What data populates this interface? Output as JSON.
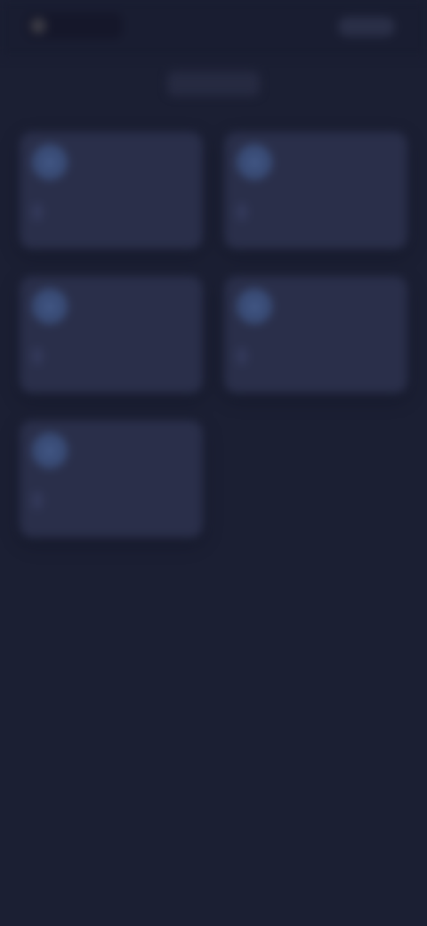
{
  "header": {
    "app_name": "",
    "action_label": ""
  },
  "page": {
    "title": ""
  },
  "cards": [
    {
      "label": "",
      "icon": "circle-icon"
    },
    {
      "label": "",
      "icon": "circle-icon"
    },
    {
      "label": "",
      "icon": "circle-icon"
    },
    {
      "label": "",
      "icon": "circle-icon"
    },
    {
      "label": "",
      "icon": "circle-icon"
    }
  ],
  "colors": {
    "background": "#1b1f33",
    "card": "#2a2f4a",
    "icon": "#3a4d78"
  }
}
